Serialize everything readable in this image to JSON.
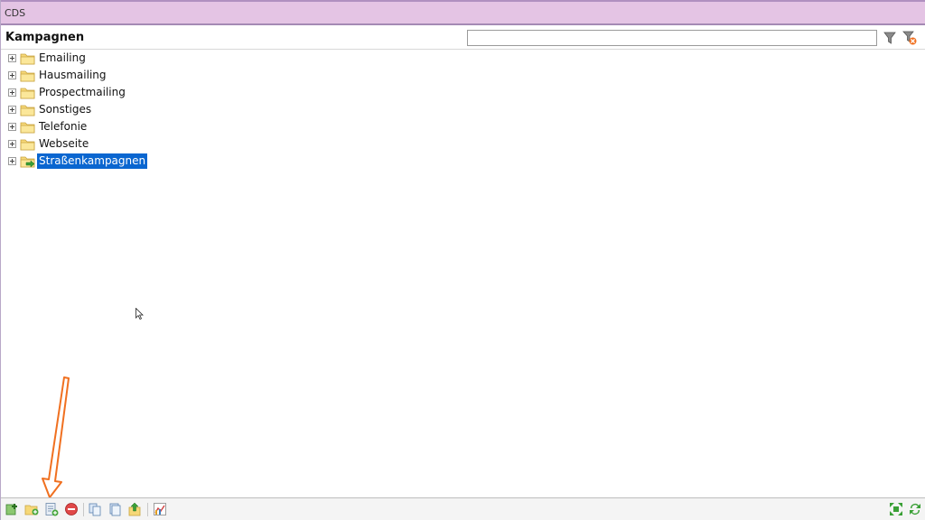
{
  "window": {
    "title": "CDS"
  },
  "header": {
    "title": "Kampagnen",
    "search_value": ""
  },
  "tree": {
    "items": [
      {
        "label": "Emailing",
        "icon": "folder-icon",
        "selected": false
      },
      {
        "label": "Hausmailing",
        "icon": "folder-icon",
        "selected": false
      },
      {
        "label": "Prospectmailing",
        "icon": "folder-icon",
        "selected": false
      },
      {
        "label": "Sonstiges",
        "icon": "folder-icon",
        "selected": false
      },
      {
        "label": "Telefonie",
        "icon": "folder-icon",
        "selected": false
      },
      {
        "label": "Webseite",
        "icon": "folder-icon",
        "selected": false
      },
      {
        "label": "Straßenkampagnen",
        "icon": "folder-arrow-icon",
        "selected": true
      }
    ]
  },
  "toolbar": {
    "buttons": [
      "add-campaign-icon",
      "add-folder-icon",
      "new-document-icon",
      "delete-icon",
      "copy-icon",
      "duplicate-icon",
      "export-icon",
      "chart-icon"
    ],
    "right_buttons": [
      "expand-all-icon",
      "refresh-icon"
    ]
  },
  "colors": {
    "titlebar": "#e4c4e4",
    "selection": "#0a66d0",
    "annotation": "#f07020"
  }
}
